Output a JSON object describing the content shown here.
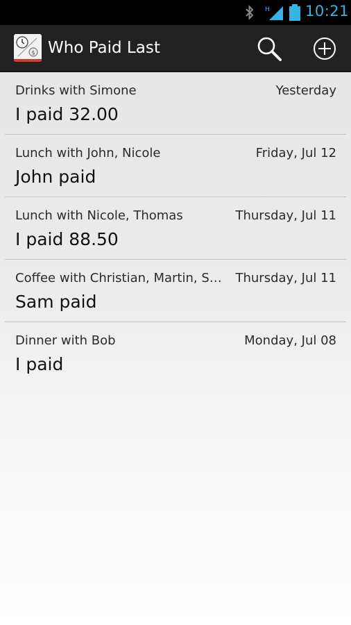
{
  "status_bar": {
    "time": "10:21",
    "network_label": "H",
    "icons": [
      "bluetooth-icon",
      "signal-icon",
      "battery-icon"
    ],
    "accent_color": "#33b5e5"
  },
  "action_bar": {
    "title": "Who Paid Last",
    "actions": [
      "search-icon",
      "add-icon"
    ]
  },
  "entries": [
    {
      "title": "Drinks with Simone",
      "date": "Yesterday",
      "payer": "I paid 32.00"
    },
    {
      "title": "Lunch with John, Nicole",
      "date": "Friday, Jul 12",
      "payer": "John paid"
    },
    {
      "title": "Lunch with Nicole, Thomas",
      "date": "Thursday, Jul 11",
      "payer": "I paid 88.50"
    },
    {
      "title": "Coffee with Christian, Martin, Sam",
      "date": "Thursday, Jul 11",
      "payer": "Sam paid"
    },
    {
      "title": "Dinner with Bob",
      "date": "Monday, Jul 08",
      "payer": "I paid"
    }
  ]
}
